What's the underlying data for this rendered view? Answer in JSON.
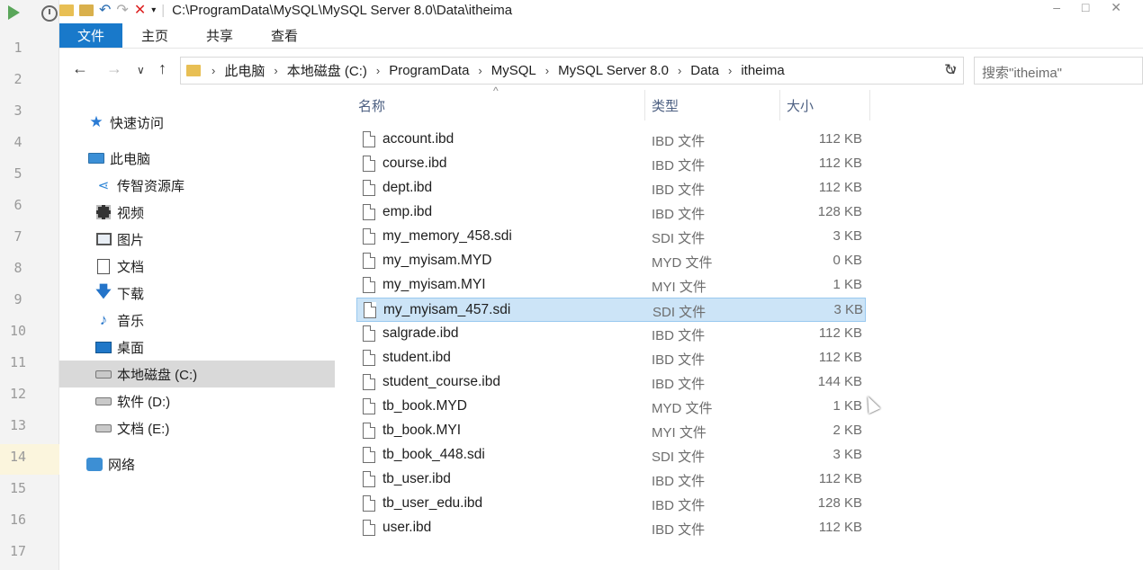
{
  "gutter": {
    "line_numbers": [
      "1",
      "2",
      "3",
      "4",
      "5",
      "6",
      "7",
      "8",
      "9",
      "10",
      "11",
      "12",
      "13",
      "14",
      "15",
      "16",
      "17"
    ]
  },
  "titlebar": {
    "path": "C:\\ProgramData\\MySQL\\MySQL Server 8.0\\Data\\itheima"
  },
  "ribbon": {
    "tabs": [
      "文件",
      "主页",
      "共享",
      "查看"
    ]
  },
  "address": {
    "breadcrumbs": [
      "此电脑",
      "本地磁盘 (C:)",
      "ProgramData",
      "MySQL",
      "MySQL Server 8.0",
      "Data",
      "itheima"
    ]
  },
  "search": {
    "placeholder": "搜索\"itheima\""
  },
  "navpane": {
    "items": [
      {
        "label": "快速访问",
        "icon": "star-icon"
      },
      {
        "label": "此电脑",
        "icon": "computer-icon"
      },
      {
        "label": "传智资源库",
        "icon": "share-icon"
      },
      {
        "label": "视频",
        "icon": "video-icon"
      },
      {
        "label": "图片",
        "icon": "pictures-icon"
      },
      {
        "label": "文档",
        "icon": "documents-icon"
      },
      {
        "label": "下载",
        "icon": "download-icon"
      },
      {
        "label": "音乐",
        "icon": "music-icon"
      },
      {
        "label": "桌面",
        "icon": "desktop-icon"
      },
      {
        "label": "本地磁盘 (C:)",
        "icon": "drive-icon",
        "selected": true
      },
      {
        "label": "软件 (D:)",
        "icon": "drive-icon"
      },
      {
        "label": "文档 (E:)",
        "icon": "drive-icon"
      },
      {
        "label": "网络",
        "icon": "network-icon"
      }
    ]
  },
  "columns": {
    "name": "名称",
    "type": "类型",
    "size": "大小"
  },
  "files": [
    {
      "name": "account.ibd",
      "type": "IBD 文件",
      "size": "112 KB"
    },
    {
      "name": "course.ibd",
      "type": "IBD 文件",
      "size": "112 KB"
    },
    {
      "name": "dept.ibd",
      "type": "IBD 文件",
      "size": "112 KB"
    },
    {
      "name": "emp.ibd",
      "type": "IBD 文件",
      "size": "128 KB"
    },
    {
      "name": "my_memory_458.sdi",
      "type": "SDI 文件",
      "size": "3 KB"
    },
    {
      "name": "my_myisam.MYD",
      "type": "MYD 文件",
      "size": "0 KB"
    },
    {
      "name": "my_myisam.MYI",
      "type": "MYI 文件",
      "size": "1 KB"
    },
    {
      "name": "my_myisam_457.sdi",
      "type": "SDI 文件",
      "size": "3 KB",
      "selected": true
    },
    {
      "name": "salgrade.ibd",
      "type": "IBD 文件",
      "size": "112 KB"
    },
    {
      "name": "student.ibd",
      "type": "IBD 文件",
      "size": "112 KB"
    },
    {
      "name": "student_course.ibd",
      "type": "IBD 文件",
      "size": "144 KB"
    },
    {
      "name": "tb_book.MYD",
      "type": "MYD 文件",
      "size": "1 KB"
    },
    {
      "name": "tb_book.MYI",
      "type": "MYI 文件",
      "size": "2 KB"
    },
    {
      "name": "tb_book_448.sdi",
      "type": "SDI 文件",
      "size": "3 KB"
    },
    {
      "name": "tb_user.ibd",
      "type": "IBD 文件",
      "size": "112 KB"
    },
    {
      "name": "tb_user_edu.ibd",
      "type": "IBD 文件",
      "size": "128 KB"
    },
    {
      "name": "user.ibd",
      "type": "IBD 文件",
      "size": "112 KB"
    }
  ],
  "colors": {
    "accent": "#1979ca",
    "selection": "#cce4f7",
    "header_text": "#4d6082"
  }
}
